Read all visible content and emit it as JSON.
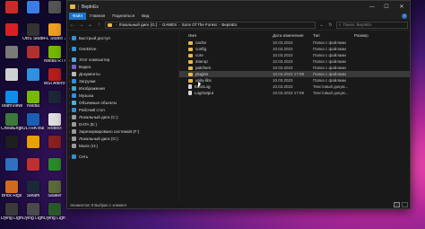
{
  "desktop": {
    "icons": [
      {
        "label": "",
        "color": "#cc2a2a",
        "col": 0,
        "row": 0
      },
      {
        "label": "",
        "color": "#3b7de8",
        "col": 1,
        "row": 0
      },
      {
        "label": "",
        "color": "#555555",
        "col": 2,
        "row": 0
      },
      {
        "label": "",
        "color": "#d81f26",
        "col": 0,
        "row": 1
      },
      {
        "label": "OBS Studio",
        "color": "#333333",
        "col": 1,
        "row": 1
      },
      {
        "label": "FL Studio 20",
        "color": "#f0a020",
        "col": 2,
        "row": 1
      },
      {
        "label": "",
        "color": "#7a7a7a",
        "col": 0,
        "row": 2
      },
      {
        "label": "",
        "color": "#b03030",
        "col": 1,
        "row": 2
      },
      {
        "label": "Nvidia RTX Voice",
        "color": "#76b900",
        "col": 2,
        "row": 2
      },
      {
        "label": "",
        "color": "#d0d0d0",
        "col": 0,
        "row": 3
      },
      {
        "label": "",
        "color": "#2f8fe0",
        "col": 1,
        "row": 3
      },
      {
        "label": "MSI Afterburner",
        "color": "#b81c1c",
        "col": 2,
        "row": 3
      },
      {
        "label": "TeamViewer",
        "color": "#0e8ee9",
        "col": 0,
        "row": 4
      },
      {
        "label": "Nvidia",
        "color": "#76b900",
        "col": 1,
        "row": 4
      },
      {
        "label": "",
        "color": "#1b2838",
        "col": 2,
        "row": 4
      },
      {
        "label": "CheatEngine",
        "color": "#3a7a3a",
        "col": 0,
        "row": 5
      },
      {
        "label": "ULTRA Builder",
        "color": "#1a5fb4",
        "col": 1,
        "row": 5
      },
      {
        "label": "Roblox",
        "color": "#e0e0e0",
        "col": 2,
        "row": 5
      },
      {
        "label": "",
        "color": "#1e1e1e",
        "col": 0,
        "row": 6
      },
      {
        "label": "",
        "color": "#e8a000",
        "col": 1,
        "row": 6
      },
      {
        "label": "",
        "color": "#8a2020",
        "col": 2,
        "row": 6
      },
      {
        "label": "",
        "color": "#3070c0",
        "col": 0,
        "row": 7
      },
      {
        "label": "",
        "color": "#c03030",
        "col": 1,
        "row": 7
      },
      {
        "label": "",
        "color": "#2a8a2a",
        "col": 2,
        "row": 7
      },
      {
        "label": "Brick Rigs",
        "color": "#d06a20",
        "col": 0,
        "row": 8
      },
      {
        "label": "Steam",
        "color": "#1b2838",
        "col": 1,
        "row": 8
      },
      {
        "label": "Stalker",
        "color": "#5a6a3a",
        "col": 2,
        "row": 8
      },
      {
        "label": "Dying Light",
        "color": "#3a3a3a",
        "col": 0,
        "row": 9
      },
      {
        "label": "Dying Light",
        "color": "#4a4a4a",
        "col": 1,
        "row": 9
      },
      {
        "label": "Dying Light",
        "color": "#2a5a2a",
        "col": 2,
        "row": 9
      }
    ]
  },
  "window": {
    "title": "BepInEx",
    "minimize": "—",
    "maximize": "☐",
    "close": "✕",
    "ribbon_tabs": [
      "Файл",
      "Главная",
      "Поделиться",
      "Вид"
    ],
    "address": {
      "parts": [
        "Локальный диск (G:)",
        "GAMES",
        "Sons Of The Forest",
        "BepInEx"
      ],
      "dropdown": "⌄"
    },
    "search_placeholder": "Поиск: BepInEx",
    "nav": [
      {
        "label": "Быстрый доступ",
        "icon_color": "#2f8fe0",
        "expander": "›"
      },
      {
        "label": "",
        "icon_color": "",
        "expander": "",
        "spacer": true
      },
      {
        "label": "OneDrive",
        "icon_color": "#2f8fe0",
        "expander": "›"
      },
      {
        "label": "",
        "icon_color": "",
        "expander": "",
        "spacer": true
      },
      {
        "label": "Этот компьютер",
        "icon_color": "#5aa0e0",
        "expander": "⌄"
      },
      {
        "label": "Видео",
        "icon_color": "#7a5ad0",
        "expander": "›"
      },
      {
        "label": "Документы",
        "icon_color": "#b8b8b8",
        "expander": "›"
      },
      {
        "label": "Загрузки",
        "icon_color": "#2f8fe0",
        "expander": "›"
      },
      {
        "label": "Изображения",
        "icon_color": "#4aa0d0",
        "expander": "›"
      },
      {
        "label": "Музыка",
        "icon_color": "#2f8fe0",
        "expander": "›"
      },
      {
        "label": "Объемные объекты",
        "icon_color": "#4ab0e0",
        "expander": "›"
      },
      {
        "label": "Рабочий стол",
        "icon_color": "#3a8ad0",
        "expander": "›"
      },
      {
        "label": "Локальный диск (C:)",
        "icon_color": "#9a9a9a",
        "expander": "›"
      },
      {
        "label": "DATA (E:)",
        "icon_color": "#9a9a9a",
        "expander": "›"
      },
      {
        "label": "Зарезервировано системой (F:)",
        "icon_color": "#9a9a9a",
        "expander": "›"
      },
      {
        "label": "Локальный диск (G:)",
        "icon_color": "#9a9a9a",
        "expander": "›"
      },
      {
        "label": "Music (H:)",
        "icon_color": "#9a9a9a",
        "expander": "›"
      },
      {
        "label": "",
        "icon_color": "",
        "expander": "",
        "spacer": true
      },
      {
        "label": "Сеть",
        "icon_color": "#3a8ad0",
        "expander": "›"
      }
    ],
    "columns": {
      "name": "Имя",
      "date": "Дата изменения",
      "type": "Тип",
      "size": "Размер"
    },
    "files": [
      {
        "name": "cache",
        "date": "10.03.2023",
        "type": "Папка с файлами",
        "size": "",
        "kind": "folder",
        "selected": false
      },
      {
        "name": "config",
        "date": "10.03.2023",
        "type": "Папка с файлами",
        "size": "",
        "kind": "folder",
        "selected": false
      },
      {
        "name": "core",
        "date": "10.03.2023",
        "type": "Папка с файлами",
        "size": "",
        "kind": "folder",
        "selected": false
      },
      {
        "name": "interop",
        "date": "10.03.2023",
        "type": "Папка с файлами",
        "size": "",
        "kind": "folder",
        "selected": false
      },
      {
        "name": "patchers",
        "date": "10.03.2023",
        "type": "Папка с файлами",
        "size": "",
        "kind": "folder",
        "selected": false
      },
      {
        "name": "plugins",
        "date": "10.03.2023 17:09",
        "type": "Папка с файлами",
        "size": "",
        "kind": "folder",
        "selected": true
      },
      {
        "name": "unity-libs",
        "date": "10.03.2023",
        "type": "Папка с файлами",
        "size": "",
        "kind": "folder",
        "selected": false
      },
      {
        "name": "ErrorLog",
        "date": "10.03.2023",
        "type": "Текстовый докум...",
        "size": "",
        "kind": "doc",
        "selected": false
      },
      {
        "name": "LogOutput",
        "date": "10.03.2023 17:09",
        "type": "Текстовый докум...",
        "size": "",
        "kind": "doc",
        "selected": false
      }
    ],
    "status": "Элементов: 9   Выбран 1 элемент"
  }
}
